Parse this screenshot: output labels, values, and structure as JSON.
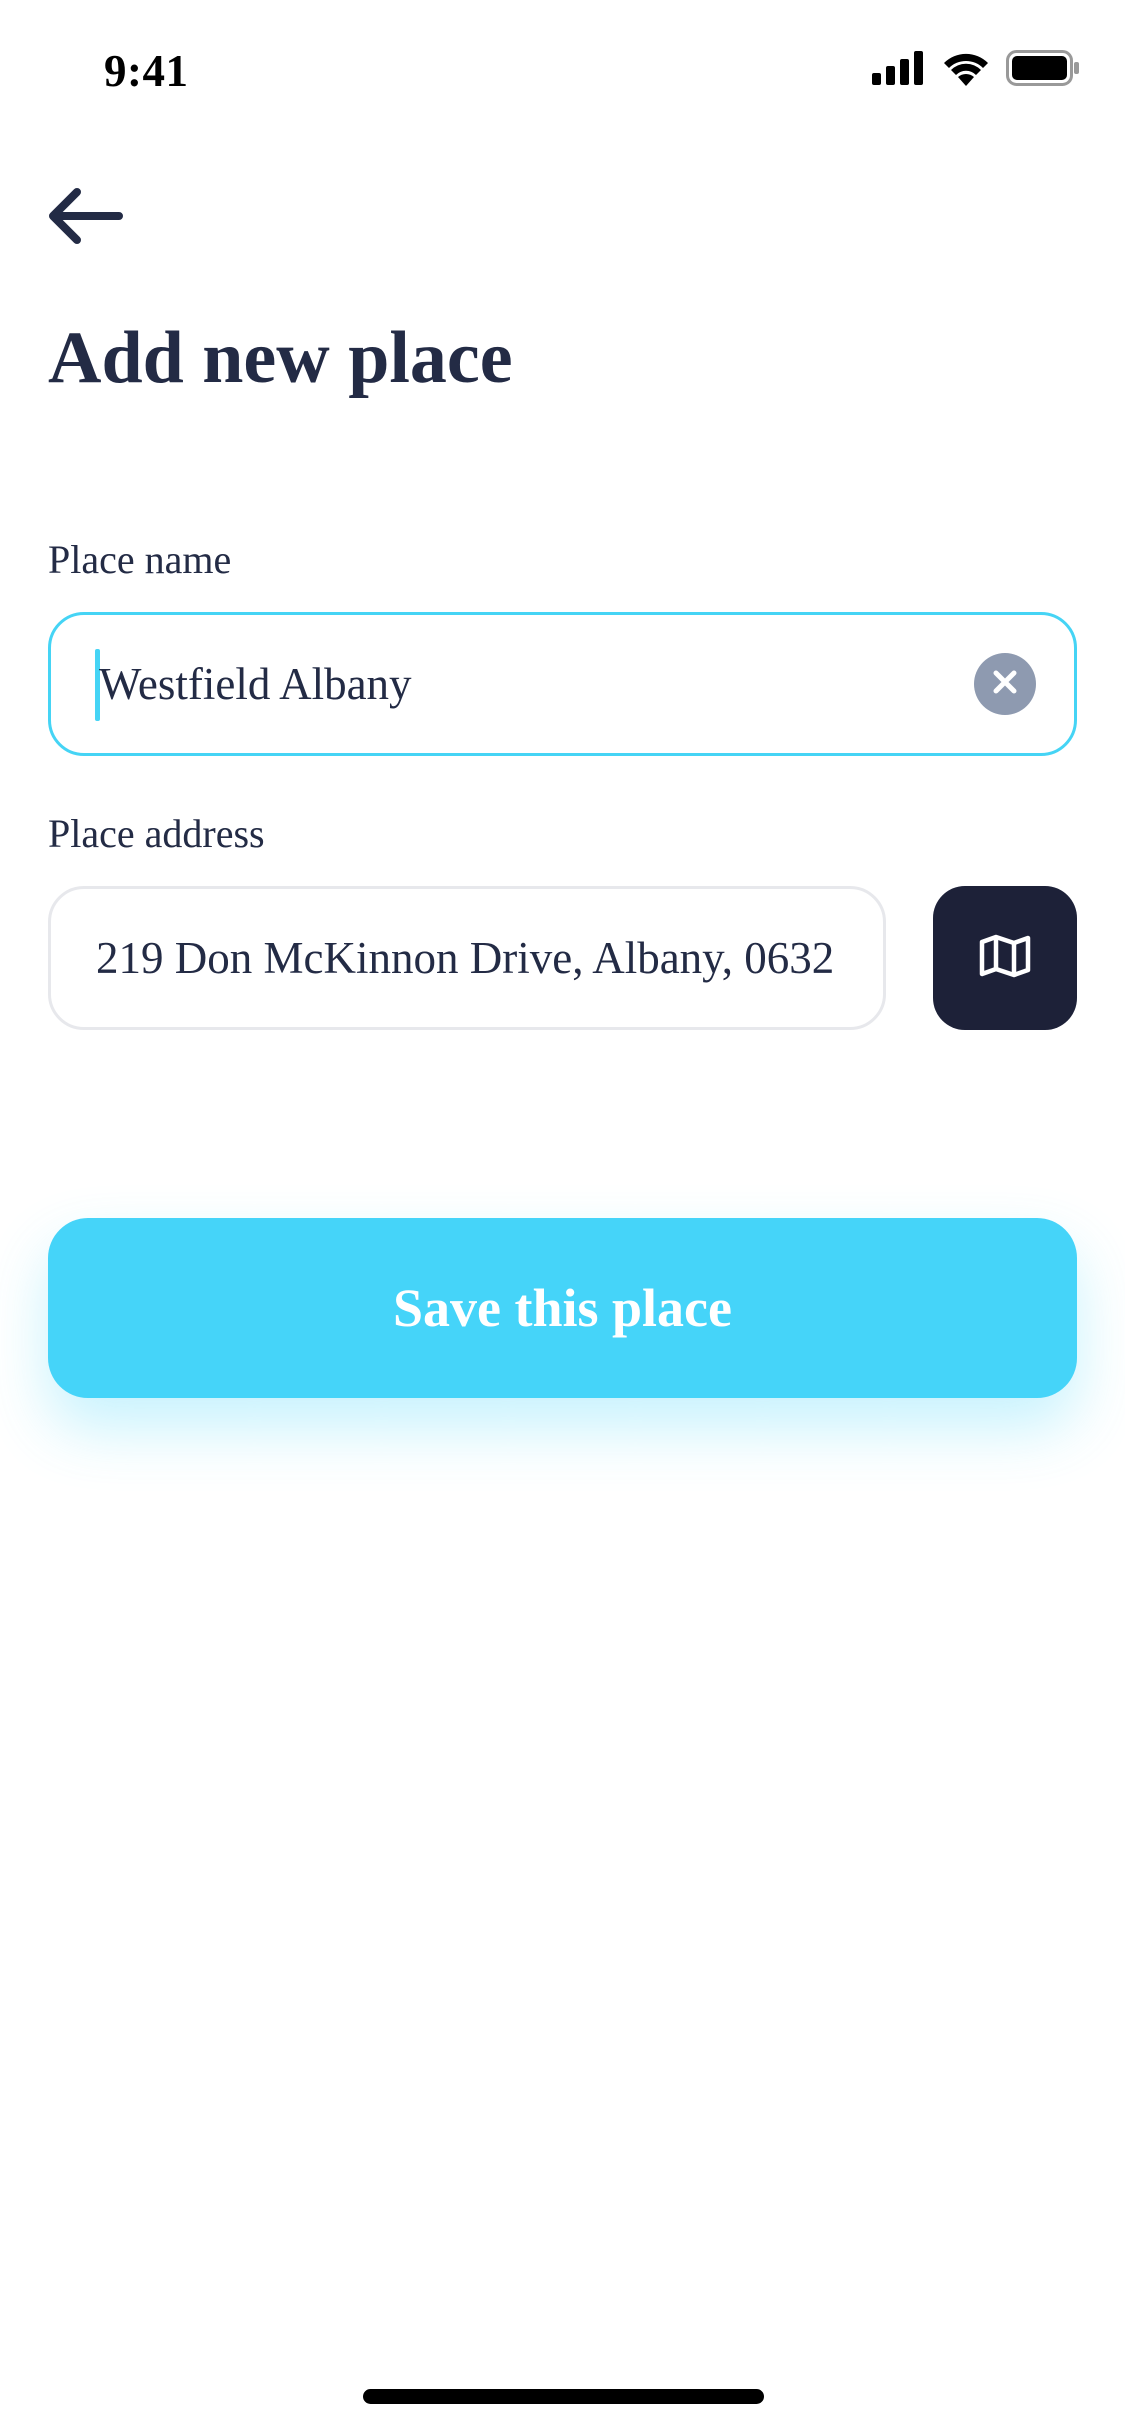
{
  "status_bar": {
    "time": "9:41",
    "icons": [
      "cellular-signal-icon",
      "wifi-icon",
      "battery-icon"
    ]
  },
  "header": {
    "back_icon": "arrow-left-icon",
    "title": "Add new place"
  },
  "form": {
    "place_name": {
      "label": "Place name",
      "value": "Westfield Albany",
      "clear_icon": "clear-circle-icon",
      "focused": true
    },
    "place_address": {
      "label": "Place address",
      "value": "219 Don McKinnon Drive, Albany, 0632",
      "map_icon": "map-icon"
    }
  },
  "actions": {
    "save_label": "Save this place"
  },
  "colors": {
    "accent": "#45d4f9",
    "text": "#232b45",
    "dark_button": "#1d2138",
    "clear_button": "#8e9ab0",
    "input_border": "#e7e8ec"
  }
}
